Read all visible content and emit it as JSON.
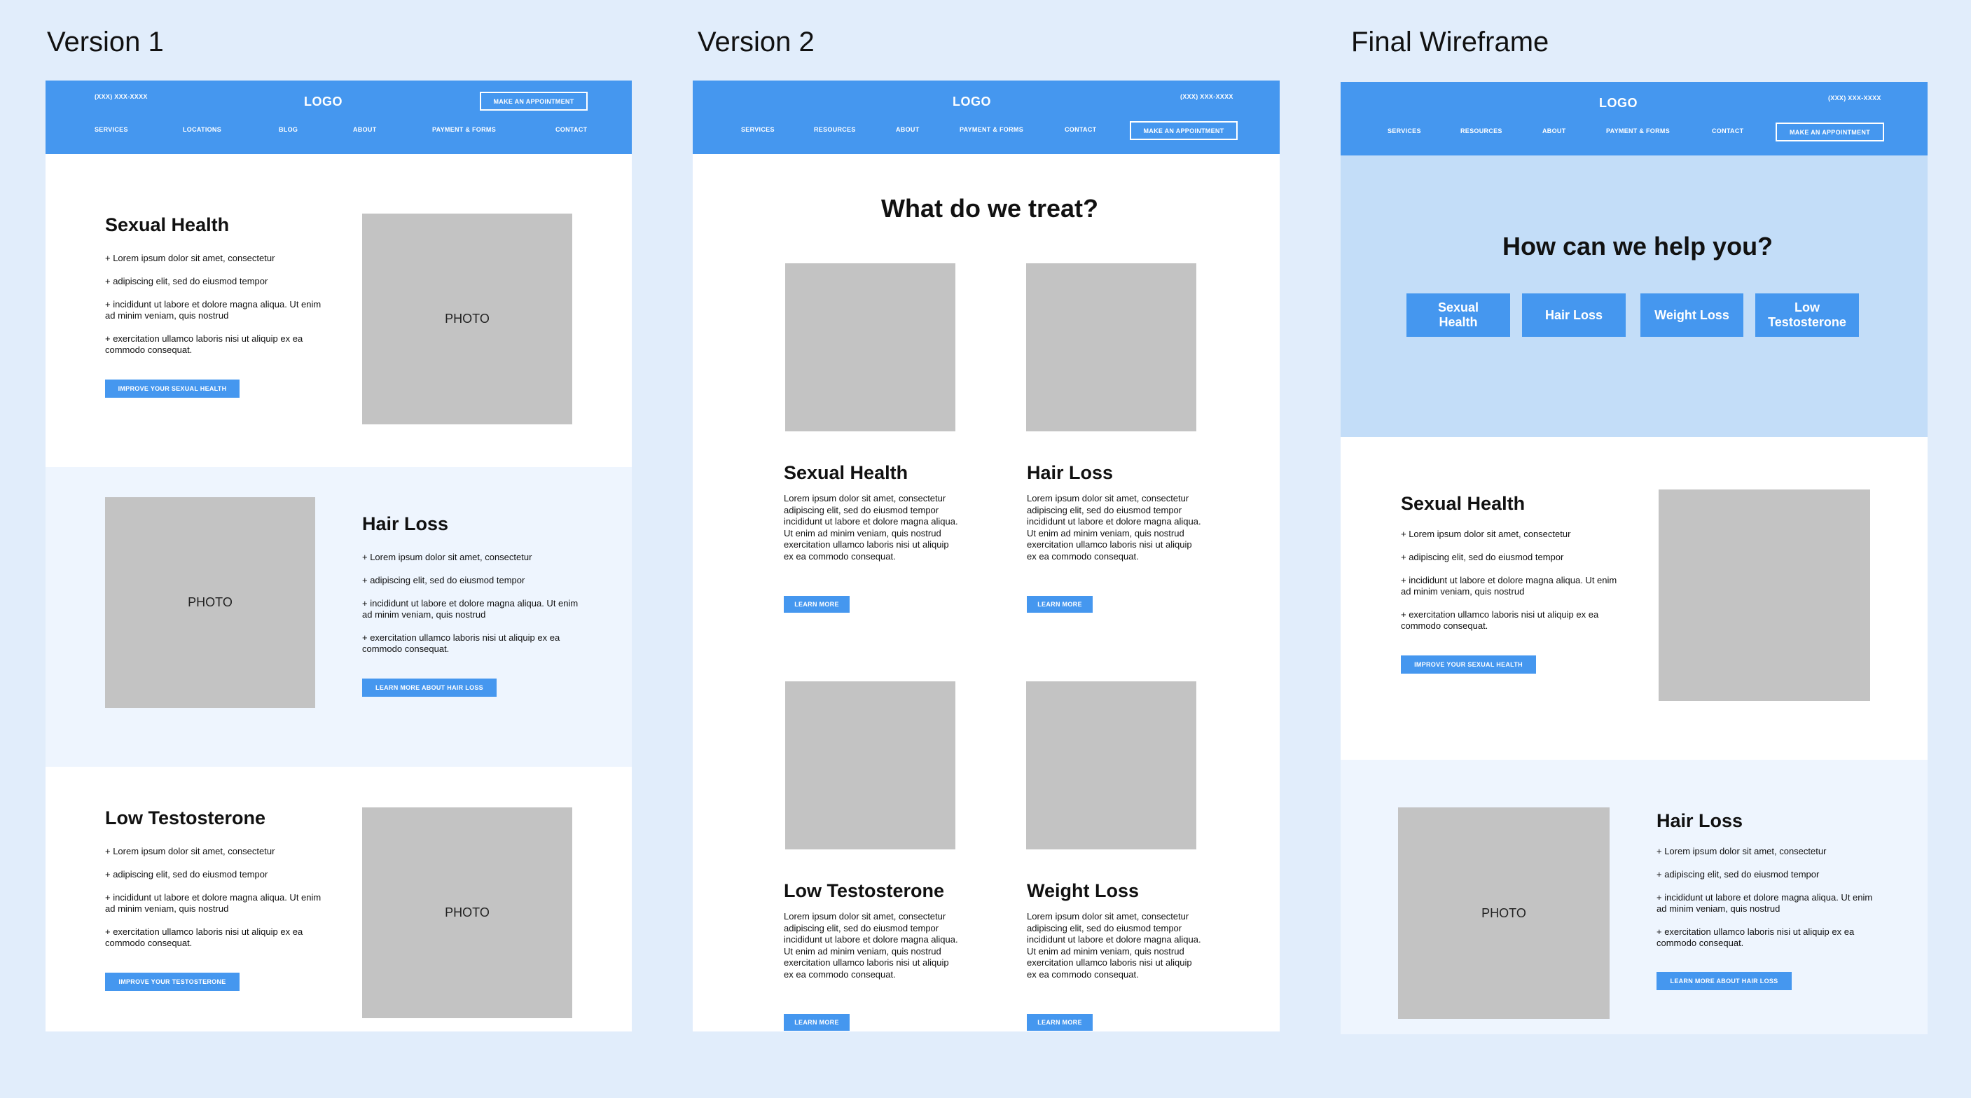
{
  "titles": {
    "v1": "Version 1",
    "v2": "Version 2",
    "final": "Final Wireframe"
  },
  "nav": {
    "phone": "(XXX) XXX-XXXX",
    "logo": "LOGO",
    "appointment": "MAKE AN APPOINTMENT",
    "v1_links": [
      "SERVICES",
      "LOCATIONS",
      "BLOG",
      "ABOUT",
      "PAYMENT & FORMS",
      "CONTACT"
    ],
    "v2_links": [
      "SERVICES",
      "RESOURCES",
      "ABOUT",
      "PAYMENT & FORMS",
      "CONTACT"
    ]
  },
  "bullets": [
    "+ Lorem ipsum dolor sit amet, consectetur",
    "+ adipiscing elit, sed do eiusmod tempor",
    "+ incididunt ut labore et dolore magna aliqua. Ut enim ad minim veniam, quis nostrud",
    "+ exercitation ullamco laboris nisi ut aliquip ex ea commodo consequat."
  ],
  "paragraph": "Lorem ipsum dolor sit amet, consectetur adipiscing elit, sed do eiusmod tempor incididunt ut labore et dolore magna aliqua. Ut enim ad minim veniam, quis nostrud exercitation ullamco laboris nisi ut aliquip ex ea commodo consequat.",
  "photo_label": "PHOTO",
  "v1": {
    "s1": {
      "heading": "Sexual Health",
      "button": "IMPROVE YOUR SEXUAL HEALTH"
    },
    "s2": {
      "heading": "Hair Loss",
      "button": "LEARN MORE ABOUT HAIR LOSS"
    },
    "s3": {
      "heading": "Low Testosterone",
      "button": "IMPROVE YOUR TESTOSTERONE"
    }
  },
  "v2": {
    "heading": "What do we treat?",
    "cards": [
      {
        "title": "Sexual Health",
        "button": "LEARN MORE"
      },
      {
        "title": "Hair Loss",
        "button": "LEARN MORE"
      },
      {
        "title": "Low Testosterone",
        "button": "LEARN MORE"
      },
      {
        "title": "Weight Loss",
        "button": "LEARN MORE"
      }
    ]
  },
  "final": {
    "heading": "How can we help you?",
    "help_buttons": [
      "Sexual Health",
      "Hair Loss",
      "Weight Loss",
      "Low Testosterone"
    ],
    "s1": {
      "heading": "Sexual Health",
      "button": "IMPROVE YOUR SEXUAL HEALTH"
    },
    "s2": {
      "heading": "Hair Loss",
      "button": "LEARN MORE ABOUT HAIR LOSS"
    }
  },
  "colors": {
    "accent": "#4597ef",
    "page_bg": "#e1edfb",
    "light_section": "#eef5fe",
    "hero_bg": "#c3ddf8",
    "photo": "#c3c3c3"
  }
}
